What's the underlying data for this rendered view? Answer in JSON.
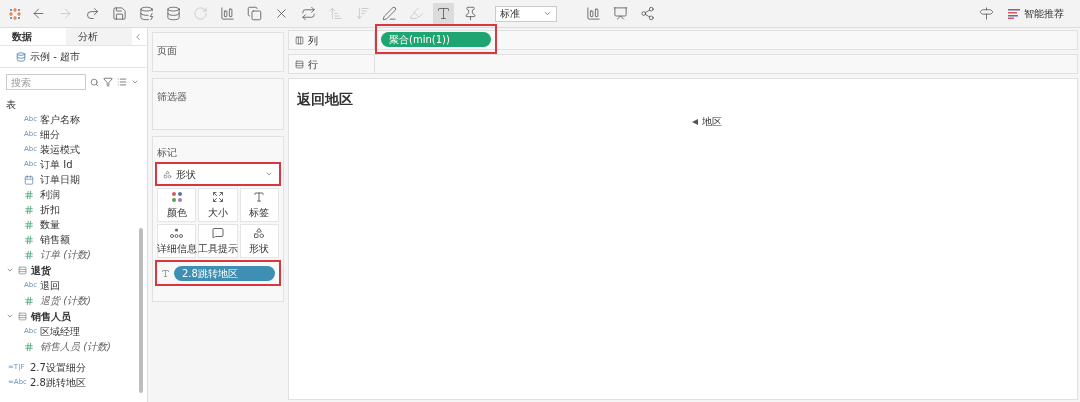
{
  "toolbar": {
    "items": [
      {
        "kind": "logo",
        "disabled": false
      },
      {
        "kind": "back",
        "disabled": false
      },
      {
        "kind": "forward",
        "disabled": true
      },
      {
        "kind": "redo",
        "disabled": false
      },
      {
        "kind": "save",
        "disabled": false
      },
      {
        "kind": "datasource-add",
        "disabled": false
      },
      {
        "kind": "datasource-pause",
        "disabled": false
      },
      {
        "kind": "refresh",
        "disabled": true
      },
      {
        "kind": "sheet-add",
        "disabled": false
      },
      {
        "kind": "sheet-duplicate",
        "disabled": false
      },
      {
        "kind": "sheet-clear",
        "disabled": false
      },
      {
        "kind": "swap",
        "disabled": false
      },
      {
        "kind": "sort-asc",
        "disabled": true
      },
      {
        "kind": "sort-desc",
        "disabled": true
      },
      {
        "kind": "highlight",
        "disabled": false
      },
      {
        "kind": "group",
        "disabled": true
      },
      {
        "kind": "labels",
        "disabled": false
      },
      {
        "kind": "pin",
        "disabled": false
      }
    ],
    "fit": {
      "value": "标准"
    },
    "right_items": [
      {
        "kind": "chart",
        "disabled": false
      },
      {
        "kind": "presentation",
        "disabled": false
      },
      {
        "kind": "share",
        "disabled": false
      }
    ],
    "recommend": {
      "label": "智能推荐"
    }
  },
  "sidebar": {
    "tabs": [
      {
        "label": "数据",
        "selected": true
      },
      {
        "label": "分析",
        "selected": false
      }
    ],
    "datasource": "示例 - 超市",
    "search": {
      "placeholder": "搜索"
    },
    "groups": [
      {
        "name": "表",
        "collapsible": false,
        "fields": [
          {
            "name": "客户名称",
            "kind": "string",
            "type_label": "Abc",
            "italic": false
          },
          {
            "name": "细分",
            "kind": "string",
            "type_label": "Abc",
            "italic": false
          },
          {
            "name": "装运模式",
            "kind": "string",
            "type_label": "Abc",
            "italic": false
          },
          {
            "name": "订单 Id",
            "kind": "string",
            "type_label": "Abc",
            "italic": false
          },
          {
            "name": "订单日期",
            "kind": "date",
            "italic": false
          },
          {
            "name": "利润",
            "kind": "number",
            "italic": false
          },
          {
            "name": "折扣",
            "kind": "number",
            "italic": false
          },
          {
            "name": "数量",
            "kind": "number",
            "italic": false
          },
          {
            "name": "销售额",
            "kind": "number",
            "italic": false
          },
          {
            "name": "订单 (计数)",
            "kind": "number",
            "italic": true
          }
        ]
      },
      {
        "name": "退货",
        "collapsible": true,
        "fields": [
          {
            "name": "退回",
            "kind": "string",
            "type_label": "Abc",
            "italic": false
          },
          {
            "name": "退货 (计数)",
            "kind": "number",
            "italic": true
          }
        ]
      },
      {
        "name": "销售人员",
        "collapsible": true,
        "fields": [
          {
            "name": "区域经理",
            "kind": "string",
            "type_label": "Abc",
            "italic": false
          },
          {
            "name": "销售人员 (计数)",
            "kind": "number",
            "italic": true
          }
        ]
      }
    ],
    "parameters": [
      {
        "name": "2.7设置细分",
        "type_label": "=T|F"
      },
      {
        "name": "2.8跳转地区",
        "type_label": "=Abc"
      }
    ]
  },
  "pages_card": {
    "title": "页面"
  },
  "filters_card": {
    "title": "筛选器"
  },
  "marks_card": {
    "title": "标记",
    "mark_type": {
      "value": "形状",
      "highlighted": true
    },
    "buttons": [
      {
        "label": "颜色",
        "kind": "color"
      },
      {
        "label": "大小",
        "kind": "size"
      },
      {
        "label": "标签",
        "kind": "label"
      },
      {
        "label": "详细信息",
        "kind": "detail"
      },
      {
        "label": "工具提示",
        "kind": "tooltip"
      },
      {
        "label": "形状",
        "kind": "shape"
      }
    ],
    "pill": {
      "label": "2.8跳转地区",
      "highlighted": true
    }
  },
  "columns_shelf": {
    "label": "列",
    "pill": "聚合(min(1))",
    "highlighted": true
  },
  "rows_shelf": {
    "label": "行"
  },
  "view": {
    "title": "返回地区",
    "header": "地区"
  }
}
